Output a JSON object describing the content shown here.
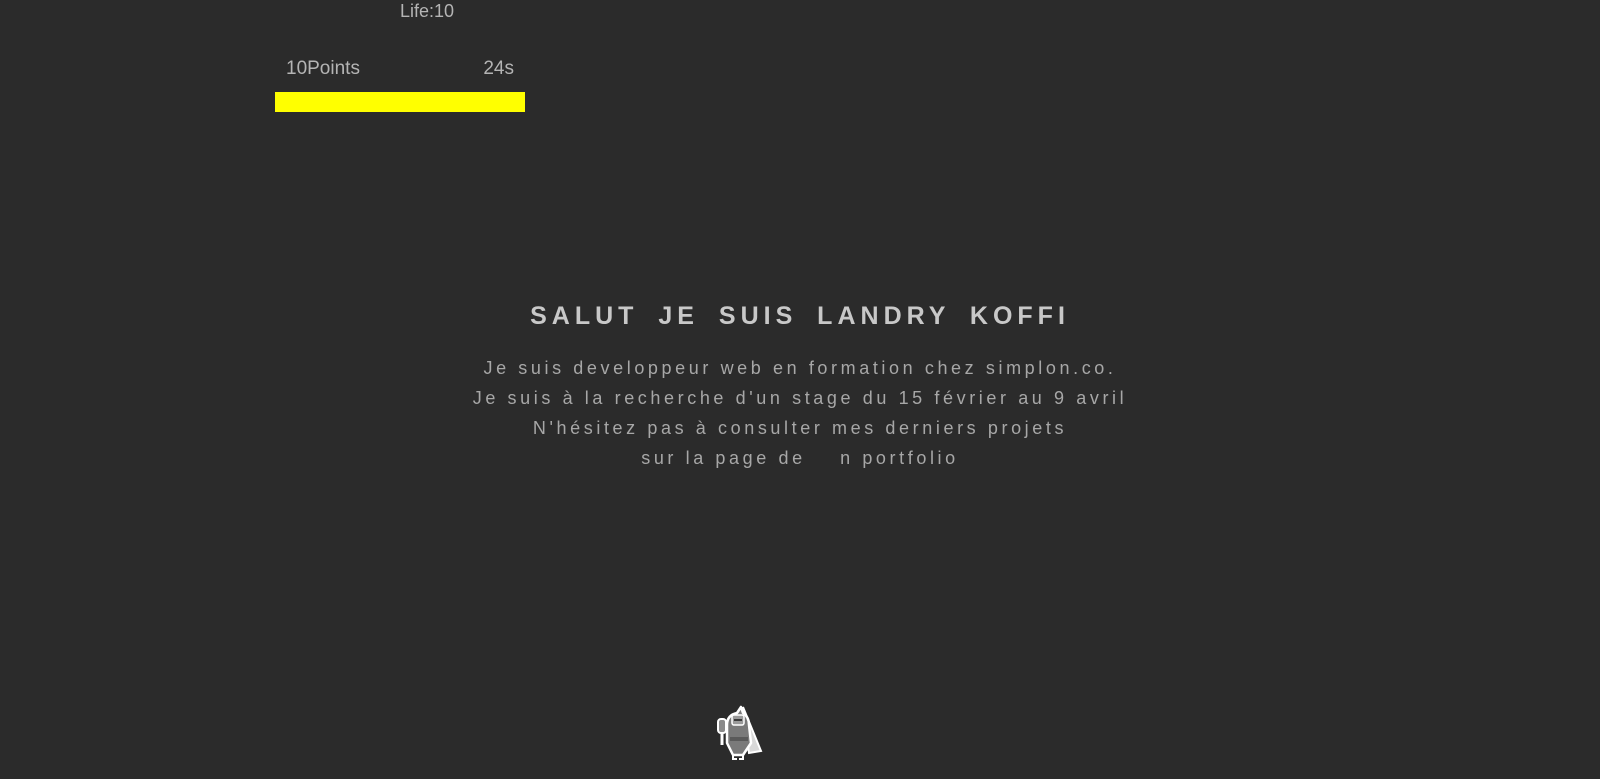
{
  "hud": {
    "life": "Life:10",
    "points": "10Points",
    "time": "24s",
    "timer_fraction": 1.0,
    "timer_color": "#ffff00"
  },
  "intro": {
    "title": "SALUT JE SUIS LANDRY KOFFI",
    "lines": [
      "Je suis developpeur web en formation chez simplon.co.",
      "Je suis à la recherche d'un stage du 15 février au 9 avril",
      "N'hésitez pas à consulter mes derniers projets",
      "sur la page de    n portfolio"
    ]
  },
  "player": {
    "icon": "knight-icon"
  },
  "colors": {
    "background": "#2b2b2b",
    "text": "#b4b4b4"
  }
}
